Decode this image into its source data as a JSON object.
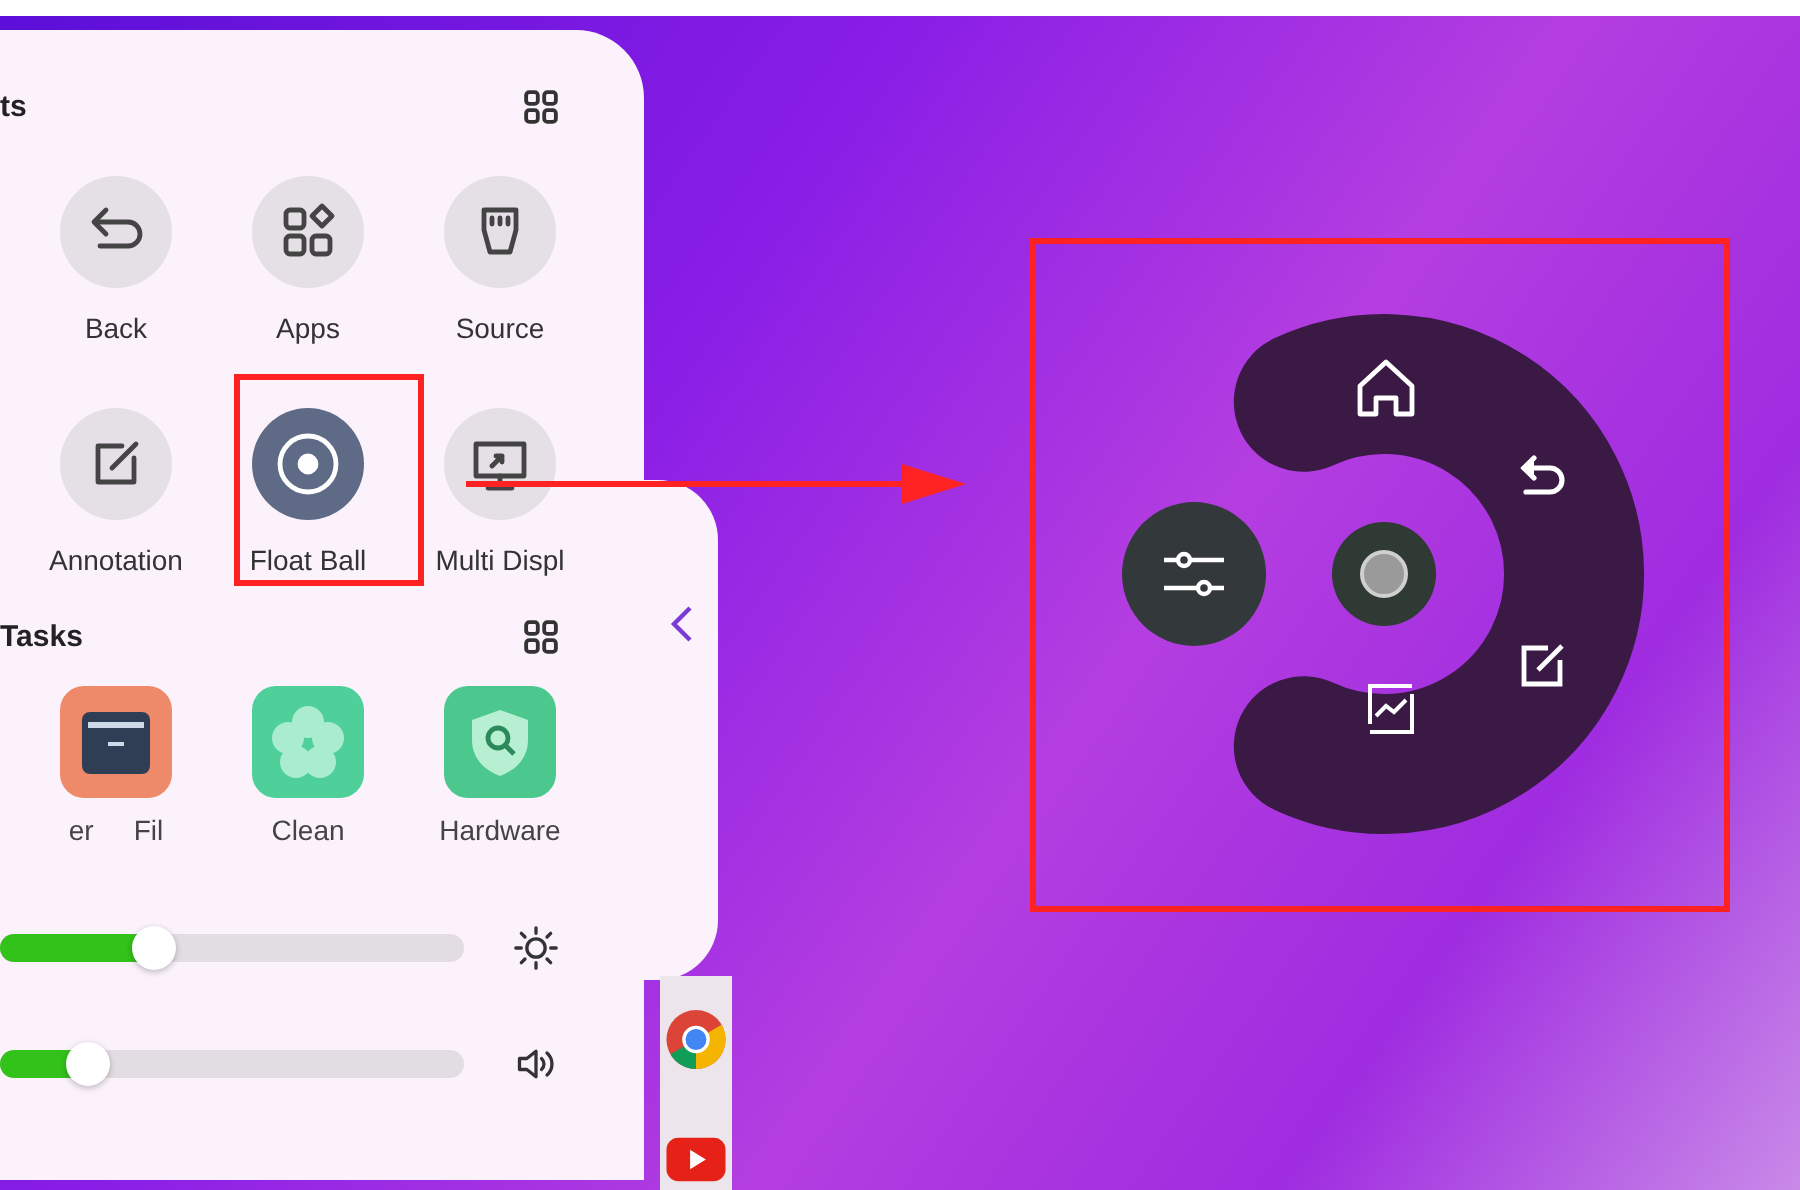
{
  "shortcuts": {
    "title": "ts",
    "items": [
      {
        "label": "Back",
        "kind": "back",
        "selected": false
      },
      {
        "label": "Apps",
        "kind": "apps",
        "selected": false
      },
      {
        "label": "Source",
        "kind": "source",
        "selected": false
      },
      {
        "label": "Annotation",
        "kind": "annotation",
        "selected": false
      },
      {
        "label": "Float Ball",
        "kind": "floatball",
        "selected": true
      },
      {
        "label": "Multi Displ",
        "kind": "display",
        "selected": false
      }
    ]
  },
  "tasks": {
    "title": "Tasks",
    "items": [
      {
        "labels": [
          "er",
          "Fil"
        ],
        "kind": "files"
      },
      {
        "labels": [
          "Clean"
        ],
        "kind": "clean"
      },
      {
        "labels": [
          "Hardware"
        ],
        "kind": "hardware"
      }
    ]
  },
  "sliders": [
    {
      "kind": "brightness",
      "level": 0.33
    },
    {
      "kind": "volume",
      "level": 0.19
    }
  ]
}
